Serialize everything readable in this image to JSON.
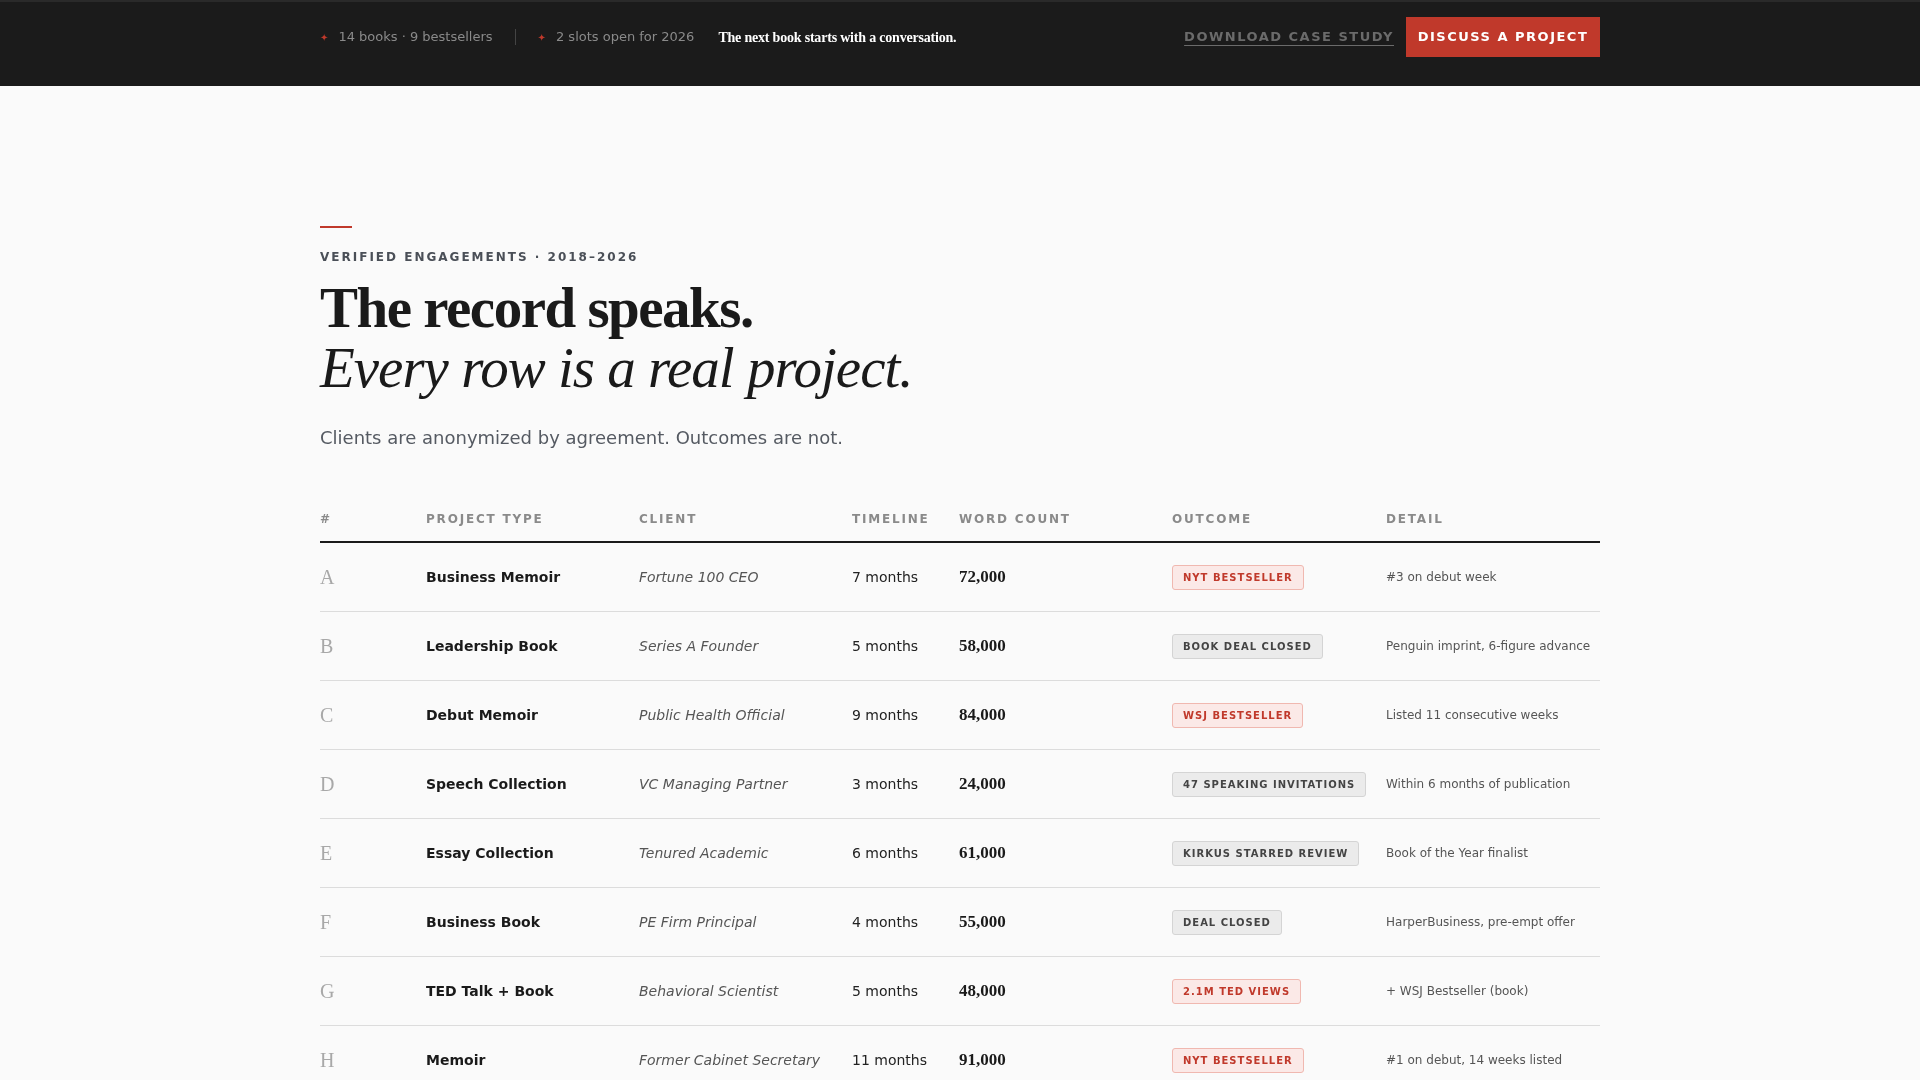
{
  "top_bar": {
    "stats": [
      "14 books · 9 bestsellers",
      "2 slots open for 2026"
    ],
    "star": "✦",
    "tagline": "The next book starts with a conversation.",
    "link": "DOWNLOAD CASE STUDY",
    "button": "DISCUSS A PROJECT"
  },
  "hero": {
    "eyebrow": "VERIFIED ENGAGEMENTS · 2018–2026",
    "title": "The record speaks.",
    "title_italic": "Every row is a real project.",
    "subtitle": "Clients are anonymized by agreement. Outcomes are not."
  },
  "table": {
    "columns": [
      "#",
      "PROJECT TYPE",
      "CLIENT",
      "TIMELINE",
      "WORD COUNT",
      "OUTCOME",
      "DETAIL"
    ],
    "rows": [
      {
        "id": "A",
        "type": "Business Memoir",
        "client": "Fortune 100 CEO",
        "timeline": "7 months",
        "words": "72,000",
        "outcome": {
          "label": "NYT BESTSELLER",
          "kind": "highlight"
        },
        "detail": "#3 on debut week"
      },
      {
        "id": "B",
        "type": "Leadership Book",
        "client": "Series A Founder",
        "timeline": "5 months",
        "words": "58,000",
        "outcome": {
          "label": "BOOK DEAL CLOSED",
          "kind": "neutral"
        },
        "detail": "Penguin imprint, 6-figure advance"
      },
      {
        "id": "C",
        "type": "Debut Memoir",
        "client": "Public Health Official",
        "timeline": "9 months",
        "words": "84,000",
        "outcome": {
          "label": "WSJ BESTSELLER",
          "kind": "highlight"
        },
        "detail": "Listed 11 consecutive weeks"
      },
      {
        "id": "D",
        "type": "Speech Collection",
        "client": "VC Managing Partner",
        "timeline": "3 months",
        "words": "24,000",
        "outcome": {
          "label": "47 SPEAKING INVITATIONS",
          "kind": "neutral"
        },
        "detail": "Within 6 months of publication"
      },
      {
        "id": "E",
        "type": "Essay Collection",
        "client": "Tenured Academic",
        "timeline": "6 months",
        "words": "61,000",
        "outcome": {
          "label": "KIRKUS STARRED REVIEW",
          "kind": "neutral"
        },
        "detail": "Book of the Year finalist"
      },
      {
        "id": "F",
        "type": "Business Book",
        "client": "PE Firm Principal",
        "timeline": "4 months",
        "words": "55,000",
        "outcome": {
          "label": "DEAL CLOSED",
          "kind": "neutral"
        },
        "detail": "HarperBusiness, pre-empt offer"
      },
      {
        "id": "G",
        "type": "TED Talk + Book",
        "client": "Behavioral Scientist",
        "timeline": "5 months",
        "words": "48,000",
        "outcome": {
          "label": "2.1M TED VIEWS",
          "kind": "highlight"
        },
        "detail": "+ WSJ Bestseller (book)"
      },
      {
        "id": "H",
        "type": "Memoir",
        "client": "Former Cabinet Secretary",
        "timeline": "11 months",
        "words": "91,000",
        "outcome": {
          "label": "NYT BESTSELLER",
          "kind": "highlight"
        },
        "detail": "#1 on debut, 14 weeks listed"
      }
    ]
  }
}
